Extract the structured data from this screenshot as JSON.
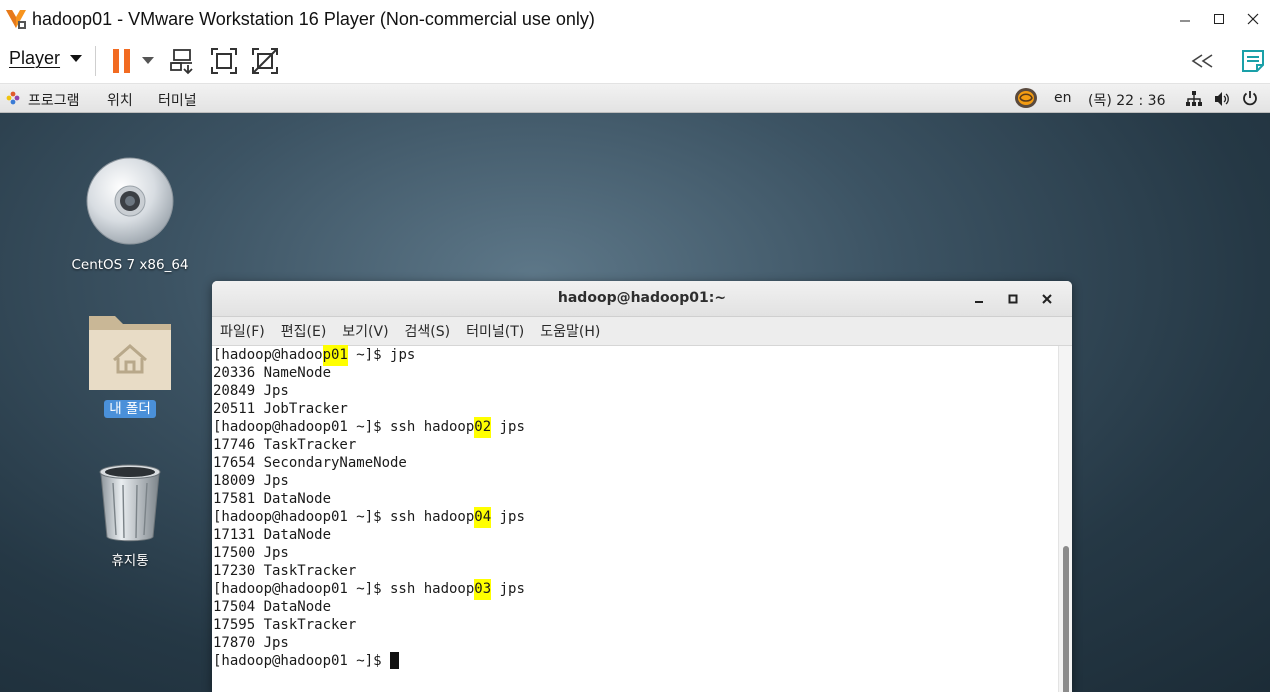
{
  "host_window": {
    "title": "hadoop01 - VMware Workstation 16 Player (Non-commercial use only)",
    "controls": [
      "minimize",
      "maximize",
      "close"
    ]
  },
  "player_toolbar": {
    "menu_label": "Player",
    "icons": [
      "pause-icon",
      "dropdown-arrow-icon",
      "send-ctrl-alt-del-icon",
      "fullscreen-icon",
      "unity-icon",
      "collapse-toolbar-icon",
      "notes-icon"
    ]
  },
  "gnome_topbar": {
    "menus": [
      "프로그램",
      "위치",
      "터미널"
    ],
    "language": "en",
    "clock": "(목) 22 : 36"
  },
  "desktop": {
    "icons": [
      {
        "label": "CentOS 7 x86_64",
        "kind": "disc"
      },
      {
        "label": "내 폴더",
        "kind": "home-folder",
        "selected": true
      },
      {
        "label": "휴지통",
        "kind": "trash"
      }
    ]
  },
  "terminal": {
    "title": "hadoop@hadoop01:~",
    "menus": [
      "파일(F)",
      "편집(E)",
      "보기(V)",
      "검색(S)",
      "터미널(T)",
      "도움말(H)"
    ],
    "lines": [
      {
        "pre": "[hadoop@hadoo",
        "hl": "p01",
        "post": " ~]$ jps"
      },
      {
        "text": "20336 NameNode"
      },
      {
        "text": "20849 Jps"
      },
      {
        "text": "20511 JobTracker"
      },
      {
        "pre": "[hadoop@hadoop01 ~]$ ssh hadoop",
        "hl": "02",
        "post": " jps"
      },
      {
        "text": "17746 TaskTracker"
      },
      {
        "text": "17654 SecondaryNameNode"
      },
      {
        "text": "18009 Jps"
      },
      {
        "text": "17581 DataNode"
      },
      {
        "pre": "[hadoop@hadoop01 ~]$ ssh hadoop",
        "hl": "04",
        "post": " jps"
      },
      {
        "text": "17131 DataNode"
      },
      {
        "text": "17500 Jps"
      },
      {
        "text": "17230 TaskTracker"
      },
      {
        "pre": "[hadoop@hadoop01 ~]$ ssh hadoop",
        "hl": "03",
        "post": " jps"
      },
      {
        "text": "17504 DataNode"
      },
      {
        "text": "17595 TaskTracker"
      },
      {
        "text": "17870 Jps"
      },
      {
        "pre": "[hadoop@hadoop01 ~]$ ",
        "cursor": true
      }
    ],
    "highlight_color": "#ffff00"
  },
  "colors": {
    "vmware_orange": "#f7941e",
    "pause_orange": "#f26b21",
    "selection_blue": "#4a90d9",
    "notes_teal": "#1aa0a8"
  }
}
